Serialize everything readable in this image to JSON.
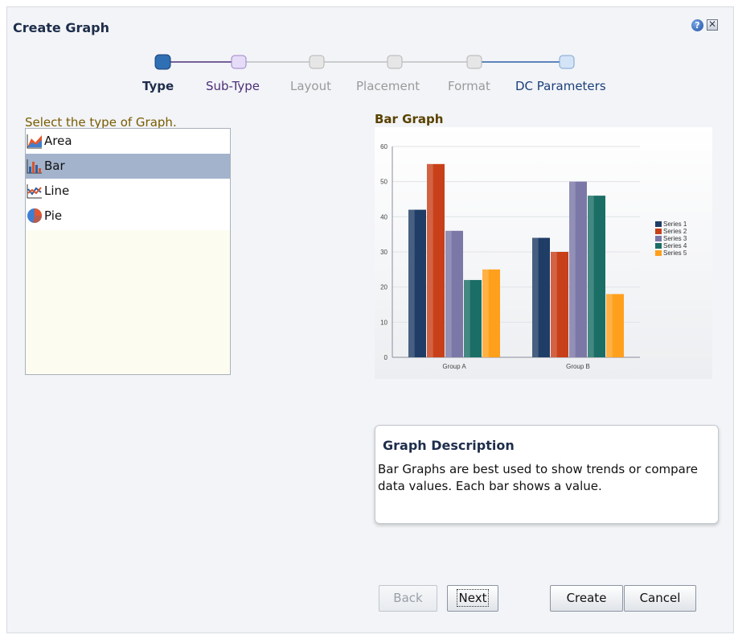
{
  "dialog": {
    "title": "Create Graph",
    "help_icon": "help-icon",
    "close_icon": "close-icon"
  },
  "train": {
    "steps": [
      {
        "label": "Type",
        "state": "current"
      },
      {
        "label": "Sub-Type",
        "state": "visited"
      },
      {
        "label": "Layout",
        "state": "disabled"
      },
      {
        "label": "Placement",
        "state": "disabled"
      },
      {
        "label": "Format",
        "state": "disabled"
      },
      {
        "label": "DC Parameters",
        "state": "enabled"
      }
    ]
  },
  "type_select": {
    "label": "Select the type of Graph.",
    "items": [
      {
        "label": "Area",
        "icon": "area-chart-icon"
      },
      {
        "label": "Bar",
        "icon": "bar-chart-icon",
        "selected": true
      },
      {
        "label": "Line",
        "icon": "line-chart-icon"
      },
      {
        "label": "Pie",
        "icon": "pie-chart-icon"
      }
    ]
  },
  "preview": {
    "title": "Bar Graph",
    "chart_data": {
      "type": "bar",
      "categories": [
        "Group A",
        "Group B"
      ],
      "series": [
        {
          "name": "Series 1",
          "values": [
            42,
            34
          ],
          "color": "#1f3d66"
        },
        {
          "name": "Series 2",
          "values": [
            55,
            30
          ],
          "color": "#c8401a"
        },
        {
          "name": "Series 3",
          "values": [
            36,
            50
          ],
          "color": "#7b78a8"
        },
        {
          "name": "Series 4",
          "values": [
            22,
            46
          ],
          "color": "#1a6e66"
        },
        {
          "name": "Series 5",
          "values": [
            25,
            18
          ],
          "color": "#ffa01c"
        }
      ],
      "ylim": [
        0,
        60
      ],
      "yticks": [
        0,
        10,
        20,
        30,
        40,
        50,
        60
      ],
      "grid": true,
      "legend": "right"
    }
  },
  "description": {
    "title": "Graph Description",
    "text": "Bar Graphs are best used to show trends or compare data values. Each bar shows a value."
  },
  "buttons": {
    "back": "Back",
    "next": "Next",
    "create": "Create",
    "cancel": "Cancel"
  }
}
